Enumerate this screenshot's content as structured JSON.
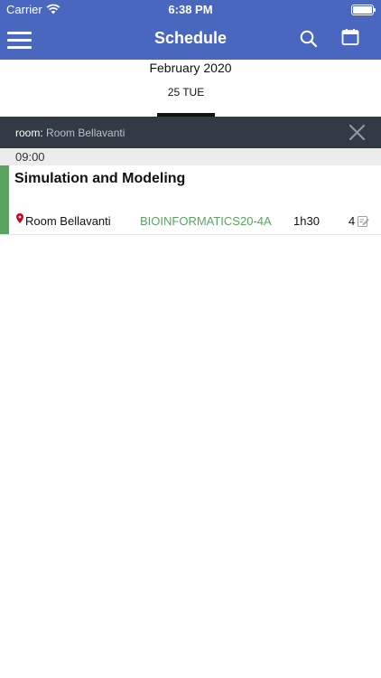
{
  "status_bar": {
    "carrier": "Carrier",
    "time": "6:38 PM"
  },
  "navbar": {
    "title": "Schedule"
  },
  "date_header": {
    "month": "February 2020",
    "day": "25 TUE"
  },
  "filter": {
    "key": "room:",
    "value": "Room Bellavanti"
  },
  "schedule": [
    {
      "time": "09:00",
      "title": "Simulation and Modeling",
      "room": "Room Bellavanti",
      "group": "BIOINFORMATICS20-4A",
      "duration": "1h30",
      "notes_count": "4"
    }
  ],
  "colors": {
    "header": "#4a67c0",
    "filter_bar": "#313a45",
    "accent": "#5aa460",
    "pin": "#d0021b"
  },
  "icons": [
    "menu-icon",
    "search-icon",
    "calendar-icon",
    "close-icon",
    "location-pin-icon",
    "note-icon",
    "wifi-icon",
    "battery-icon"
  ]
}
